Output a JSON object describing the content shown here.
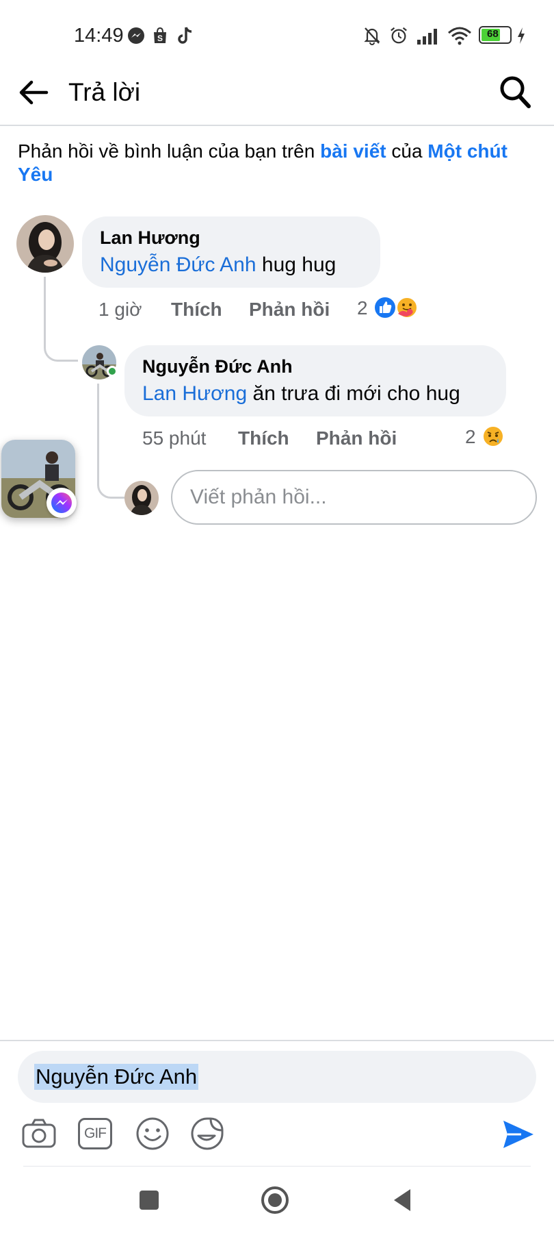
{
  "status_bar": {
    "time": "14:49",
    "battery": "68",
    "left_icons": [
      "messenger-icon",
      "shopee-icon",
      "tiktok-icon"
    ],
    "right_icons": [
      "bell-muted-icon",
      "alarm-icon",
      "signal-icon",
      "wifi-icon",
      "battery-icon",
      "charging-icon"
    ]
  },
  "header": {
    "title": "Trả lời",
    "back_icon": "arrow-left-icon",
    "search_icon": "search-icon"
  },
  "context": {
    "prefix": "Phản hồi về bình luận của bạn trên ",
    "post_link": "bài viết",
    "middle": " của ",
    "author_link": "Một chút Yêu"
  },
  "comments": [
    {
      "author": "Lan Hương",
      "mention": "Nguyễn Đức Anh",
      "text": "  hug hug",
      "time": "1 giờ",
      "like_label": "Thích",
      "reply_label": "Phản hồi",
      "reaction_count": "2",
      "reactions": [
        "like-reaction-icon",
        "care-reaction-icon"
      ]
    },
    {
      "author": "Nguyễn Đức Anh",
      "mention": "Lan Hương",
      "text": " ăn trưa đi mới cho hug",
      "time": "55 phút",
      "like_label": "Thích",
      "reply_label": "Phản hồi",
      "reaction_count": "2",
      "reactions": [
        "sad-reaction-icon"
      ]
    }
  ],
  "reply_box": {
    "placeholder": "Viết phản hồi..."
  },
  "composer": {
    "value": "Nguyễn Đức Anh",
    "tools": [
      "camera-icon",
      "gif-icon",
      "emoji-icon",
      "sticker-icon"
    ],
    "gif_label": "GIF",
    "send_icon": "send-icon"
  },
  "colors": {
    "link": "#1877f2",
    "mention": "#1a6ed8",
    "bubble": "#f0f2f5",
    "meta": "#65676b",
    "online": "#31a24c"
  }
}
